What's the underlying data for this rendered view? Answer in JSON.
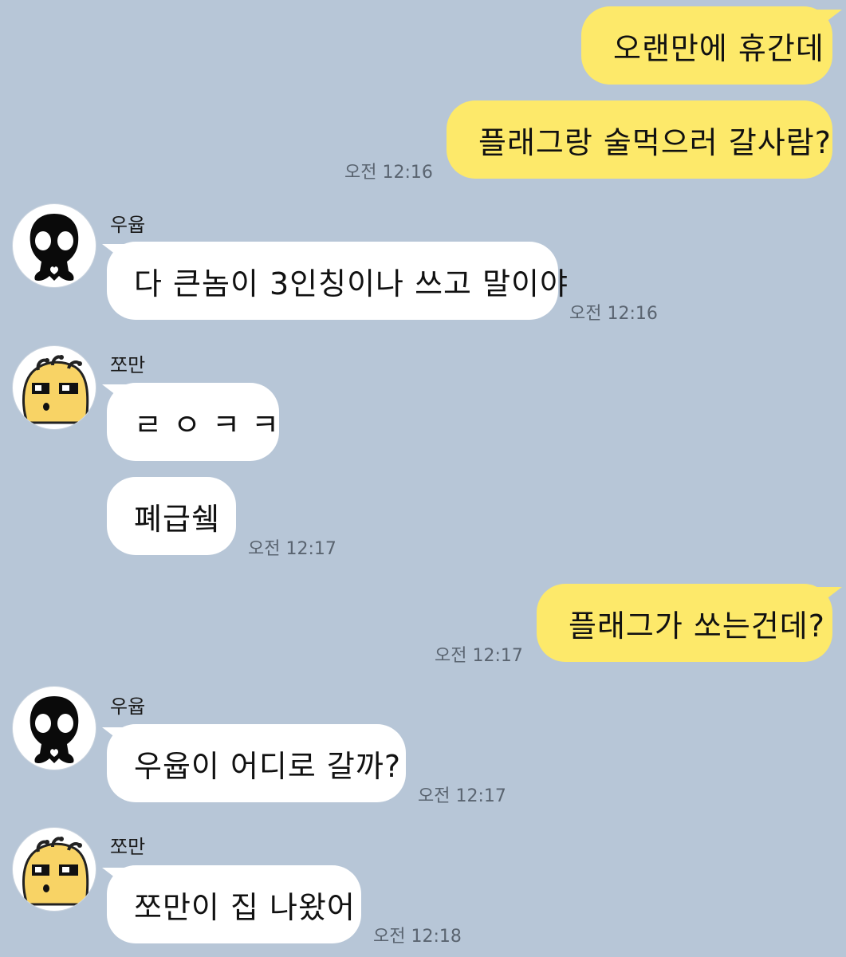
{
  "colors": {
    "background": "#b7c6d7",
    "outgoing_bubble": "#fde96a",
    "incoming_bubble": "#ffffff",
    "timestamp": "#5a6470"
  },
  "messages": [
    {
      "side": "out",
      "text": "오랜만에 휴간데"
    },
    {
      "side": "out",
      "text": "플래그랑 술먹으러 갈사람?",
      "time": "오전 12:16"
    },
    {
      "sender": "우윱",
      "avatar_icon": "skull-avatar-icon",
      "side": "in",
      "text": "다 큰놈이 3인칭이나 쓰고 말이야",
      "time": "오전 12:16"
    },
    {
      "sender": "쪼만",
      "avatar_icon": "yellow-blob-avatar-icon",
      "side": "in",
      "text": "ㄹ ㅇ ㅋ ㅋ"
    },
    {
      "side": "in",
      "text": "폐급쉨",
      "time": "오전 12:17"
    },
    {
      "side": "out",
      "text": "플래그가 쏘는건데?",
      "time": "오전 12:17"
    },
    {
      "sender": "우윱",
      "avatar_icon": "skull-avatar-icon",
      "side": "in",
      "text": "우윱이 어디로 갈까?",
      "time": "오전 12:17"
    },
    {
      "sender": "쪼만",
      "avatar_icon": "yellow-blob-avatar-icon",
      "side": "in",
      "text": "쪼만이 집 나왔어",
      "time": "오전 12:18"
    }
  ]
}
